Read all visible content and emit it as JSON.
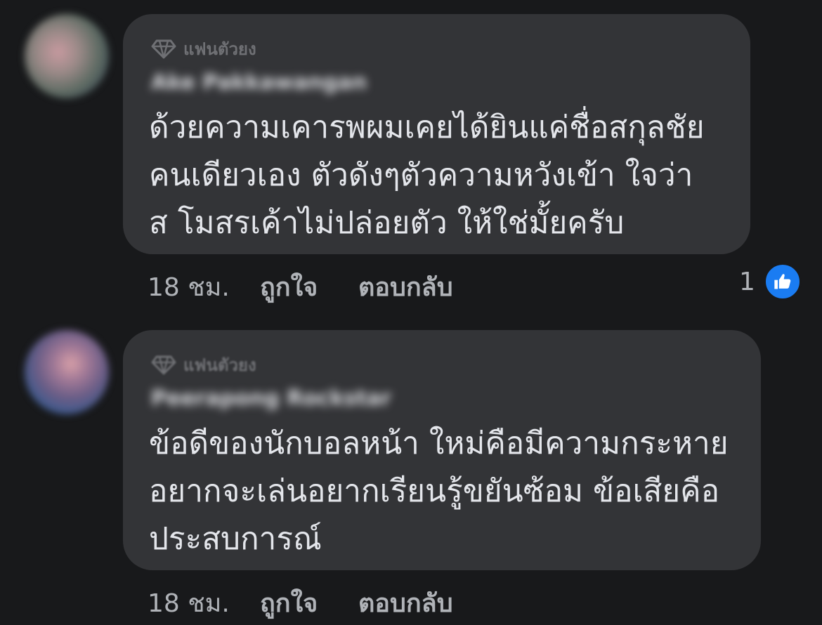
{
  "comments": [
    {
      "badge": "แฟนตัวยง",
      "author": "Ake Pakkawangan",
      "text_lines": [
        "ด้วยความเคารพผมเคยได้ยินแค่ชื่อสกุลชัย",
        "คนเดียวเอง ตัวดังๆตัวความหวังเข้า ใจว่า",
        "ส โมสรเค้าไม่ปล่อยตัว ให้ใช่มั้ยครับ"
      ],
      "time": "18 ชม.",
      "like_label": "ถูกใจ",
      "reply_label": "ตอบกลับ",
      "reaction_count": "1",
      "reaction_icon": "thumbs-up-icon",
      "accent_color": "#1a7cf2"
    },
    {
      "badge": "แฟนตัวยง",
      "author": "Peerapong Rockstar",
      "text_lines": [
        "ข้อดีของนักบอลหน้า ใหม่คือมีความกระหาย",
        "อยากจะเล่นอยากเรียนรู้ขยันซ้อม ข้อเสียคือ",
        "ประสบการณ์"
      ],
      "time": "18 ชม.",
      "like_label": "ถูกใจ",
      "reply_label": "ตอบกลับ"
    }
  ]
}
